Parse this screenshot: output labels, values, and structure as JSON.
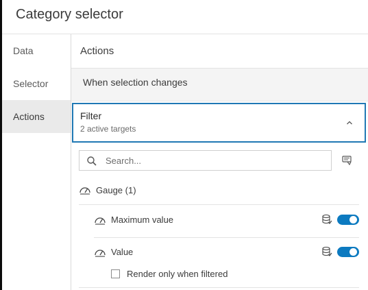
{
  "header": {
    "title": "Category selector"
  },
  "nav": {
    "items": [
      {
        "label": "Data"
      },
      {
        "label": "Selector"
      },
      {
        "label": "Actions"
      }
    ],
    "active": "Actions"
  },
  "main": {
    "title": "Actions",
    "trigger_label": "When selection changes",
    "filter": {
      "title": "Filter",
      "subtitle": "2 active targets"
    },
    "search": {
      "placeholder": "Search...",
      "value": ""
    },
    "group": {
      "label": "Gauge (1)"
    },
    "targets": [
      {
        "label": "Maximum value",
        "enabled": true
      },
      {
        "label": "Value",
        "enabled": true
      }
    ],
    "option": {
      "label": "Render only when filtered",
      "checked": false
    }
  },
  "icons": {
    "chevron": "chevron-up-icon",
    "search": "search-icon",
    "filter_settings": "filter-settings-icon",
    "gauge": "gauge-icon",
    "database": "database-icon"
  },
  "colors": {
    "accent": "#1f78b4",
    "toggle_on": "#0c7ac0"
  }
}
